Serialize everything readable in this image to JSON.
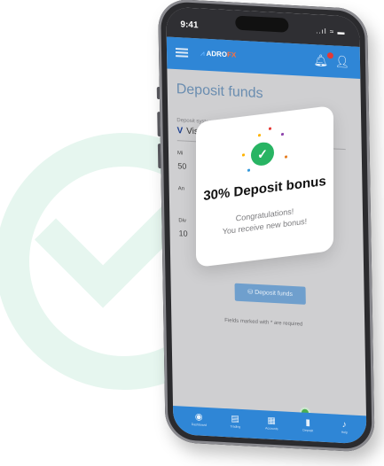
{
  "status_bar": {
    "time": "9:41",
    "signal": "..ıl ≈ ▬"
  },
  "app_bar": {
    "logo_text": "ADRO",
    "logo_suffix": "FX",
    "notification_count": "1"
  },
  "page": {
    "title": "Deposit funds",
    "deposit_system_label": "Deposit system *",
    "deposit_system_value": "Visa",
    "partial_values": [
      "Mi",
      "50",
      "An",
      "Div",
      "10"
    ],
    "deposit_button": "Deposit funds",
    "required_note": "Fields marked with * are required"
  },
  "modal": {
    "title": "30% Deposit bonus",
    "line1": "Congratulations!",
    "line2": "You receive new bonus!"
  },
  "bottom_nav": [
    {
      "label": "Dashboard"
    },
    {
      "label": "Trading"
    },
    {
      "label": "Accounts"
    },
    {
      "label": "Deposit"
    },
    {
      "label": "Help"
    }
  ],
  "colors": {
    "accent": "#2f86d6",
    "success": "#28b463",
    "bg_check": "#e6f6ef"
  }
}
